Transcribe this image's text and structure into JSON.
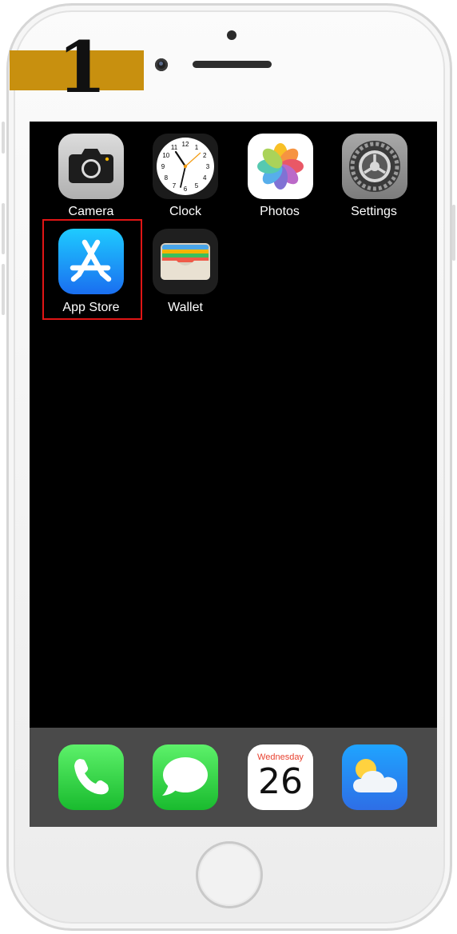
{
  "step": {
    "number": "1"
  },
  "home_screen": {
    "apps": [
      {
        "label": "Camera",
        "icon": "camera-icon"
      },
      {
        "label": "Clock",
        "icon": "clock-icon"
      },
      {
        "label": "Photos",
        "icon": "photos-icon"
      },
      {
        "label": "Settings",
        "icon": "settings-icon"
      },
      {
        "label": "App Store",
        "icon": "app-store-icon",
        "highlighted": true
      },
      {
        "label": "Wallet",
        "icon": "wallet-icon"
      }
    ],
    "clock_numbers": [
      "12",
      "1",
      "2",
      "3",
      "4",
      "5",
      "6",
      "7",
      "8",
      "9",
      "10",
      "11"
    ]
  },
  "dock": {
    "apps": [
      {
        "name": "Phone",
        "icon": "phone-icon"
      },
      {
        "name": "Messages",
        "icon": "messages-icon"
      },
      {
        "name": "Calendar",
        "icon": "calendar-icon",
        "weekday": "Wednesday",
        "day": "26"
      },
      {
        "name": "Weather",
        "icon": "weather-icon"
      }
    ]
  },
  "colors": {
    "step_band": "#c8900f",
    "highlight_border": "#e01515",
    "screen_bg": "#000000",
    "dock_bg": "#4a4a4a"
  }
}
